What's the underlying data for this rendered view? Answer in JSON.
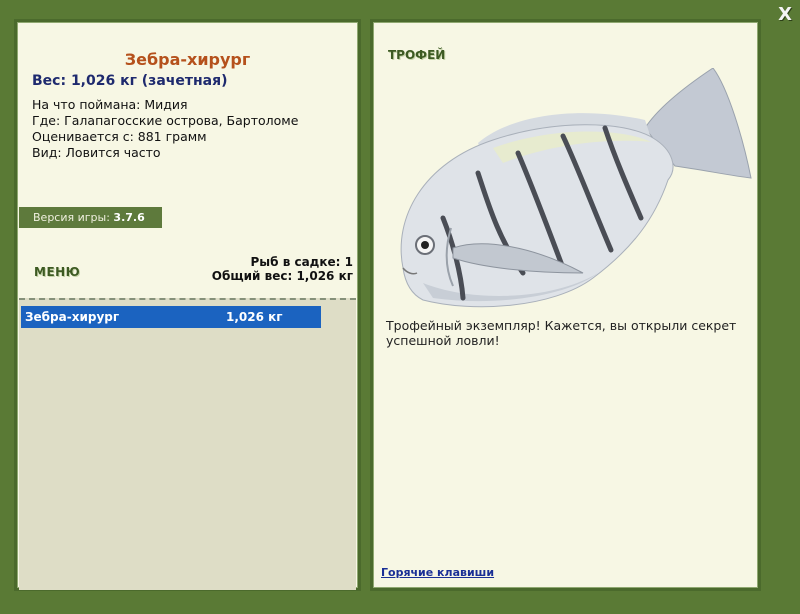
{
  "window": {
    "close_label": "X"
  },
  "fish": {
    "name": "Зебра-хирург",
    "weight_line": "Вес: 1,026 кг (зачетная)",
    "bait": "На что поймана: Мидия",
    "location": "Где: Галапагосские острова, Бартоломе",
    "min_weight": "Оценивается с: 881 грамм",
    "type": "Вид: Ловится часто"
  },
  "version": {
    "label": "Версия игры:",
    "value": "3.7.6"
  },
  "menu_label": "МЕНЮ",
  "stats": {
    "count": "Рыб в садке: 1",
    "total": "Общий вес: 1,026 кг"
  },
  "catch_list": [
    {
      "name": "Зебра-хирург",
      "weight": "1,026 кг"
    }
  ],
  "trophy": {
    "label": "ТРОФЕЙ",
    "description": "Трофейный экземпляр! Кажется, вы открыли секрет успешной ловли!"
  },
  "hotkeys_label": "Горячие клавиши"
}
